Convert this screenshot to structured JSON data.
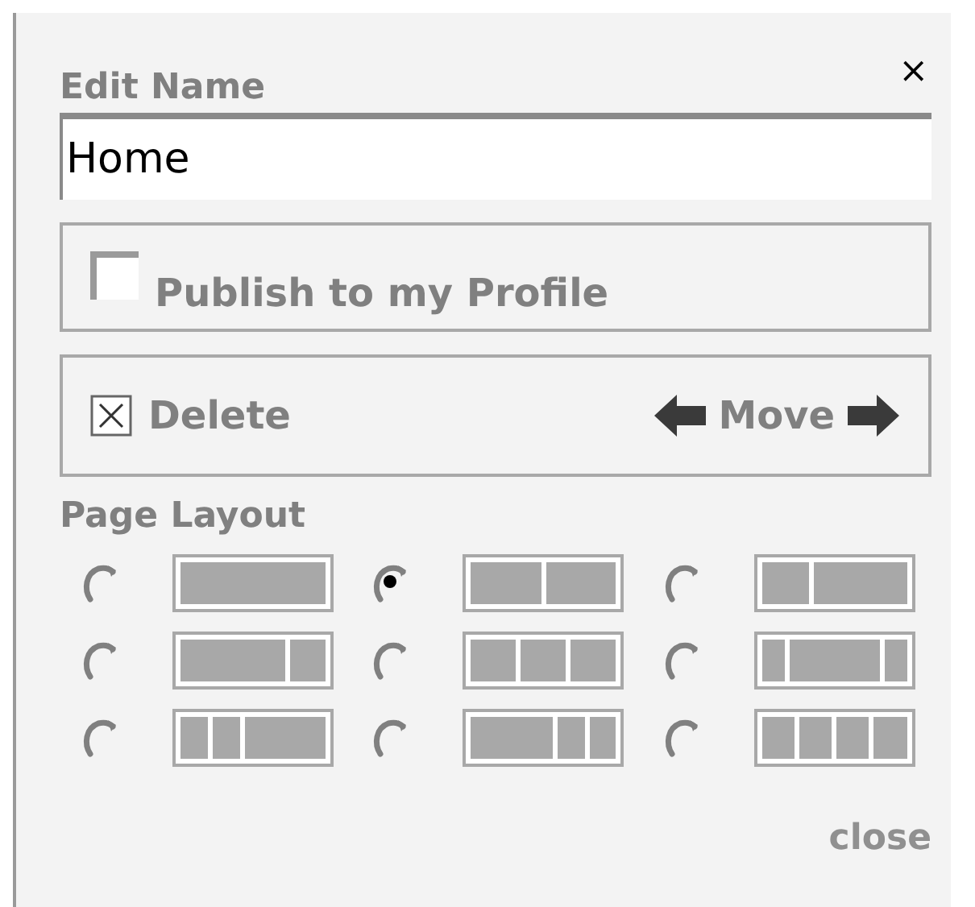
{
  "dialog": {
    "title": "Edit Name",
    "close_icon": "×"
  },
  "name_field": {
    "value": "Home"
  },
  "publish": {
    "label": "Publish to my Profile",
    "checked": false
  },
  "actions": {
    "delete": "Delete",
    "move": "Move"
  },
  "page_layout": {
    "title": "Page Layout",
    "options": [
      {
        "kind": "single",
        "selected": false
      },
      {
        "kind": "halves",
        "selected": true
      },
      {
        "kind": "narrow-wide",
        "selected": false
      },
      {
        "kind": "wide-narrow",
        "selected": false
      },
      {
        "kind": "thirds",
        "selected": false
      },
      {
        "kind": "wide-center",
        "selected": false
      },
      {
        "kind": "narrow-narrow-wide",
        "selected": false
      },
      {
        "kind": "wide-narrow-narrow",
        "selected": false
      },
      {
        "kind": "quarters",
        "selected": false
      }
    ]
  },
  "close_link": "close"
}
